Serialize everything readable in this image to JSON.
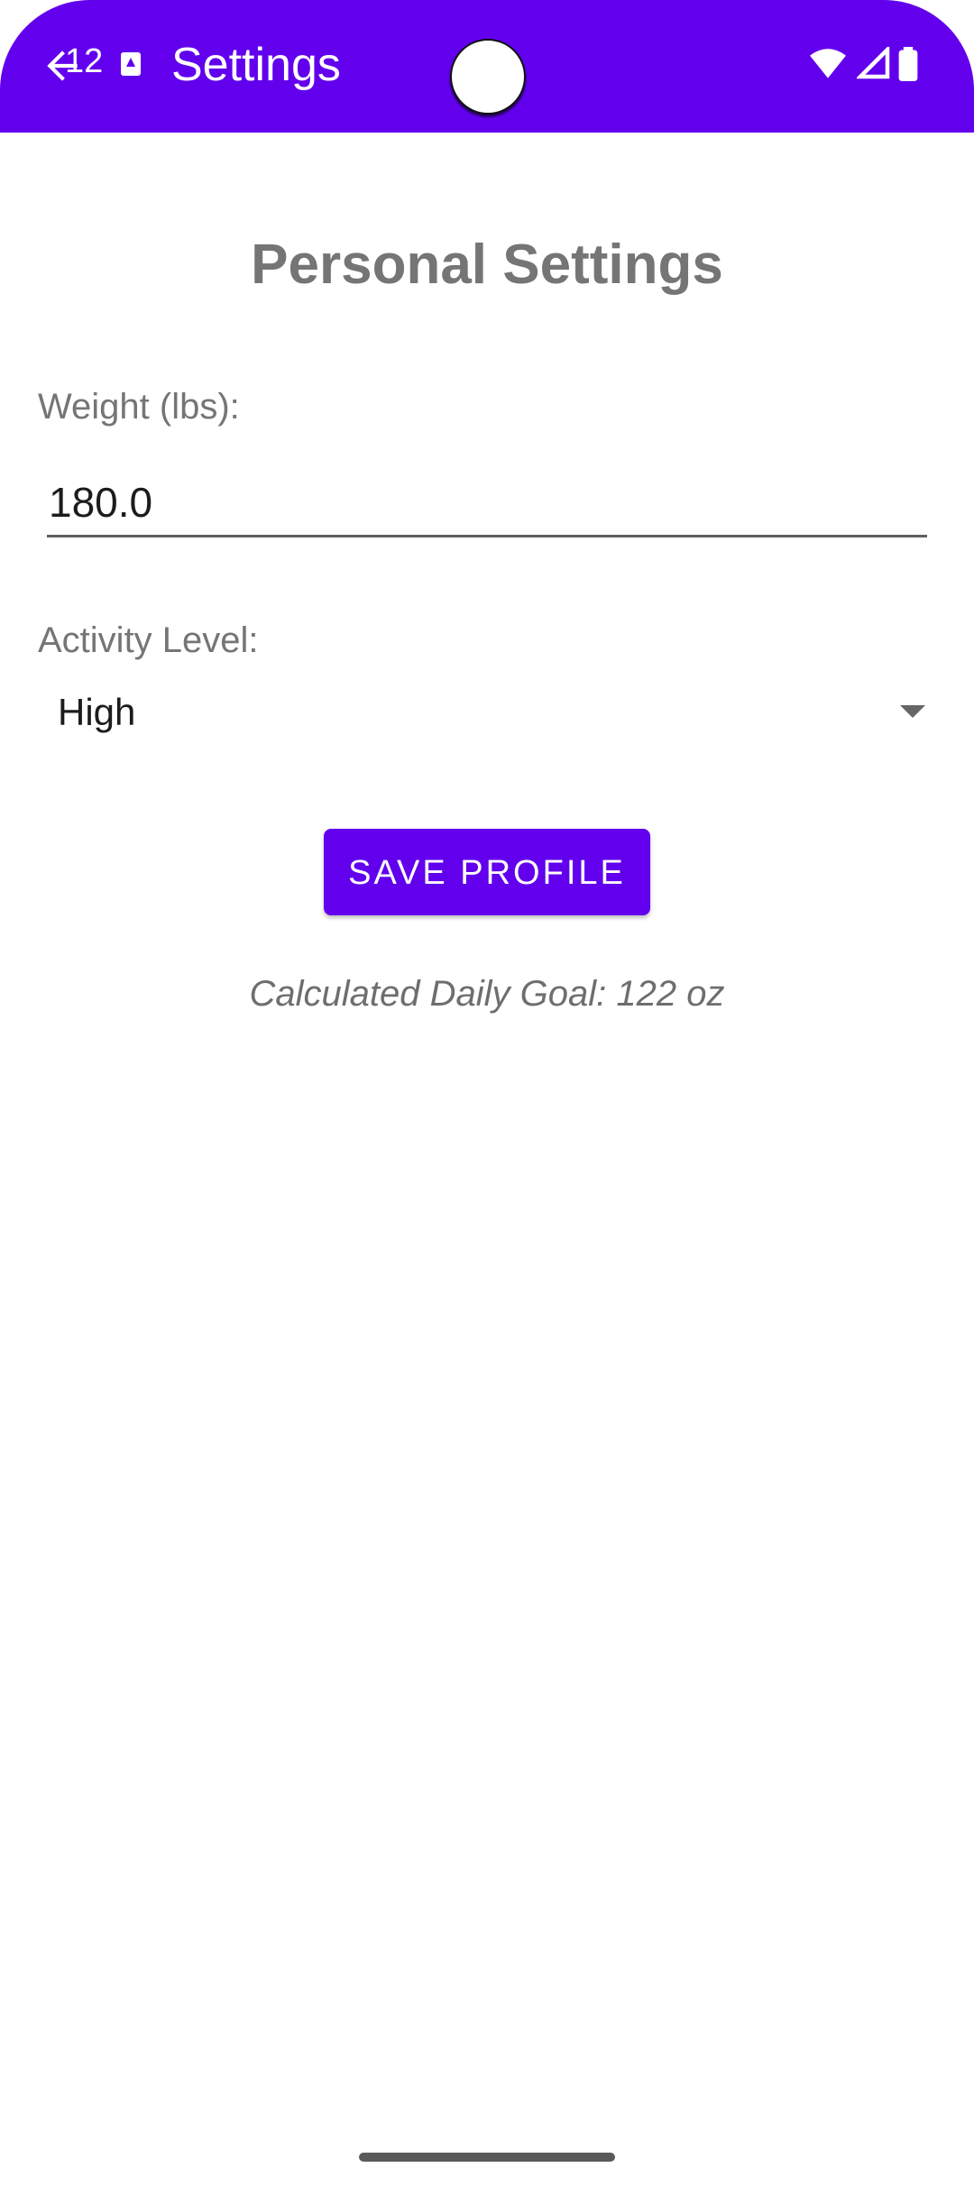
{
  "status_bar": {
    "time": "12"
  },
  "app_bar": {
    "title": "Settings",
    "color": "#6200ee",
    "back_icon": "back-arrow-icon"
  },
  "content": {
    "heading": "Personal Settings",
    "weight": {
      "label": "Weight (lbs):",
      "value": "180.0"
    },
    "activity": {
      "label": "Activity Level:",
      "selected": "High"
    },
    "save_button_label": "SAVE PROFILE",
    "goal_text": "Calculated Daily Goal: 122 oz"
  }
}
